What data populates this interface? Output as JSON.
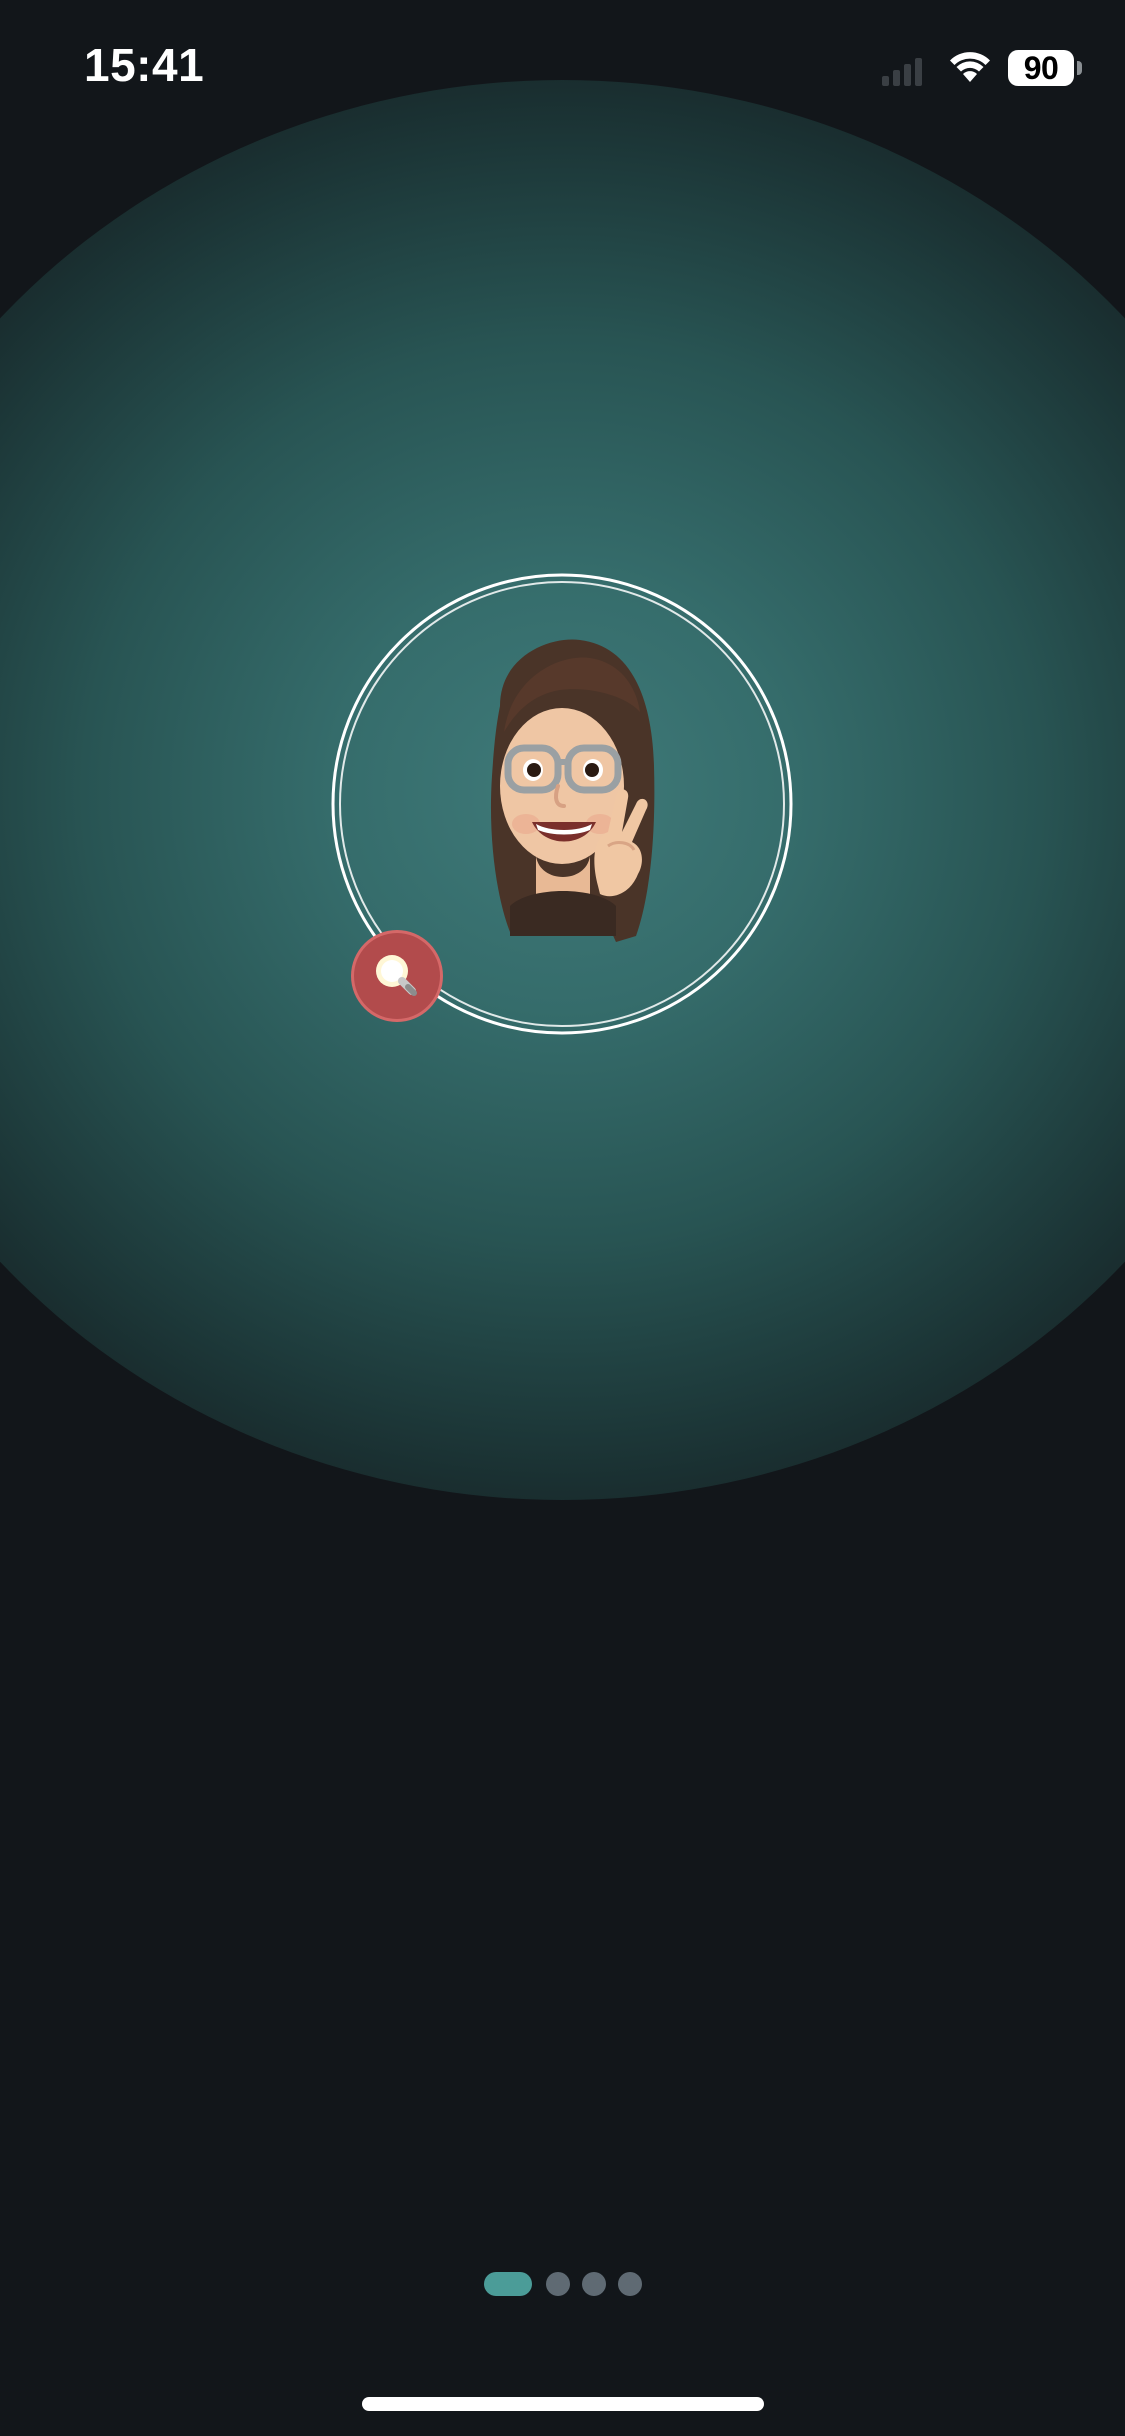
{
  "status_bar": {
    "time": "15:41",
    "battery_level": "90",
    "signal_icon": "cellular-signal-icon",
    "wifi_icon": "wifi-icon",
    "battery_icon": "battery-icon"
  },
  "avatar": {
    "icon": "memoji-avatar",
    "ring_color": "#ffffff",
    "badge_icon": "lightbulb-icon",
    "badge_color": "#b24b4c"
  },
  "pager": {
    "page_count": 4,
    "current_page": 1,
    "active_color": "#4b9c98",
    "inactive_color": "#5f6a73"
  },
  "colors": {
    "background": "#12161a",
    "glow": "#3f7a79"
  }
}
